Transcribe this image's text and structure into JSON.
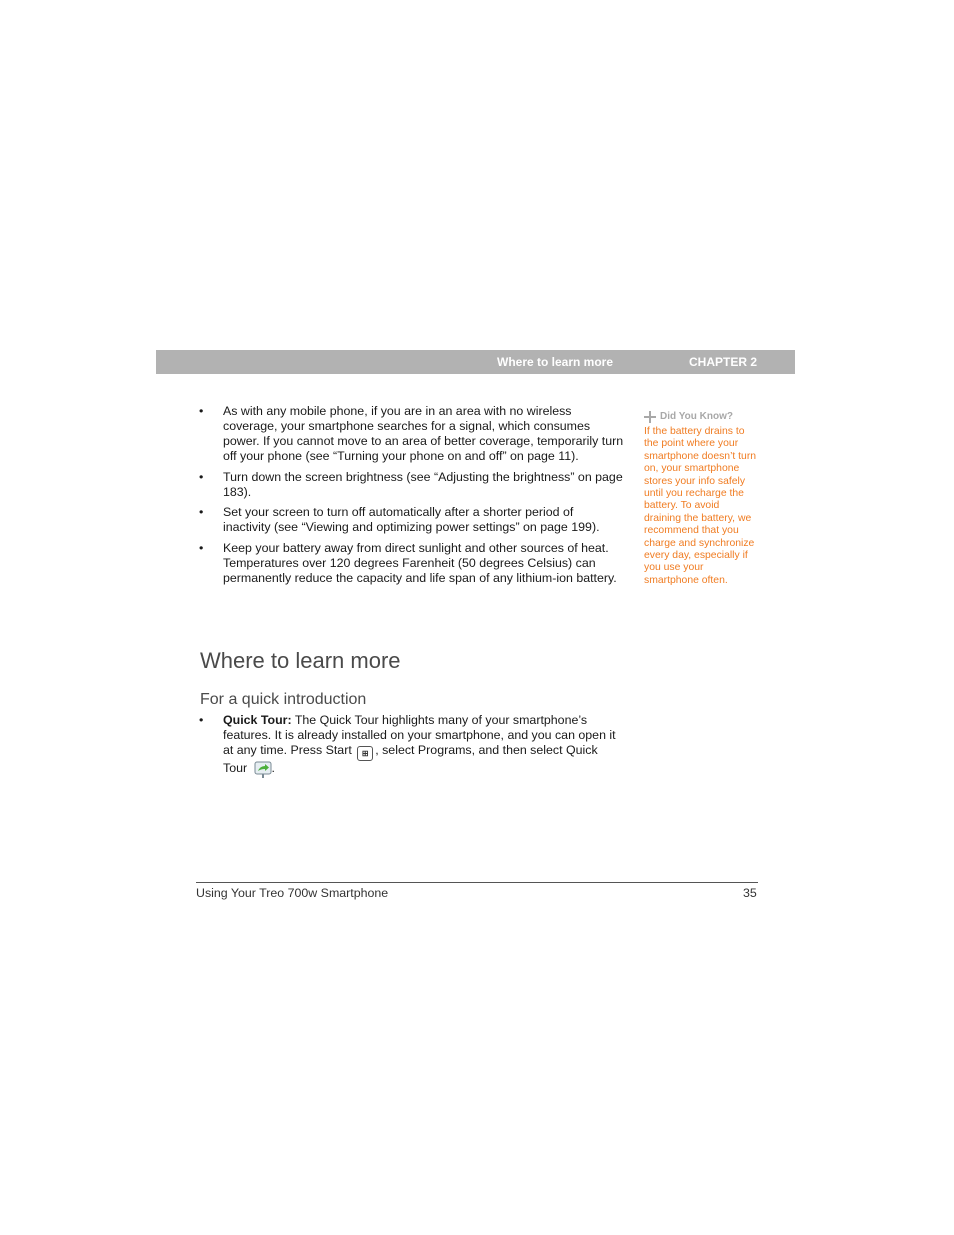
{
  "header": {
    "section_title": "Where to learn more",
    "chapter": "CHAPTER 2",
    "bar_color": "#b2b2b2"
  },
  "tips": [
    "As with any mobile phone, if you are in an area with no wireless coverage, your smartphone searches for a signal, which consumes power. If you cannot move to an area of better coverage, temporarily turn off your phone (see “Turning your phone on and off” on page 11).",
    "Turn down the screen brightness (see “Adjusting the brightness” on page 183).",
    "Set your screen to turn off automatically after a shorter period of inactivity (see “Viewing and optimizing power settings” on page 199).",
    "Keep your battery away from direct sunlight and other sources of heat. Temperatures over 120 degrees Farenheit (50 degrees Celsius) can permanently reduce the capacity and life span of any lithium-ion battery."
  ],
  "sidebar": {
    "icon": "plus-icon",
    "heading": "Did You Know?",
    "body": "If the battery drains to the point where your smartphone doesn’t turn on, your smartphone stores your info safely until you recharge the battery. To avoid draining the battery, we recommend that you charge and synchronize every day, especially if you use your smartphone often.",
    "accent_color": "#f07c22"
  },
  "section": {
    "title": "Where to learn more",
    "subtitle": "For a quick introduction",
    "item": {
      "label": "Quick Tour:",
      "text_1": " The Quick Tour highlights many of your smartphone’s features. It is already installed on your smartphone, and you can open it at any time. Press Start ",
      "start_icon": "windows-start-icon",
      "text_2": ", select Programs, and then select Quick Tour ",
      "tour_icon": "quick-tour-icon",
      "text_3": "."
    }
  },
  "footer": {
    "title": "Using Your Treo 700w Smartphone",
    "page_number": "35"
  }
}
